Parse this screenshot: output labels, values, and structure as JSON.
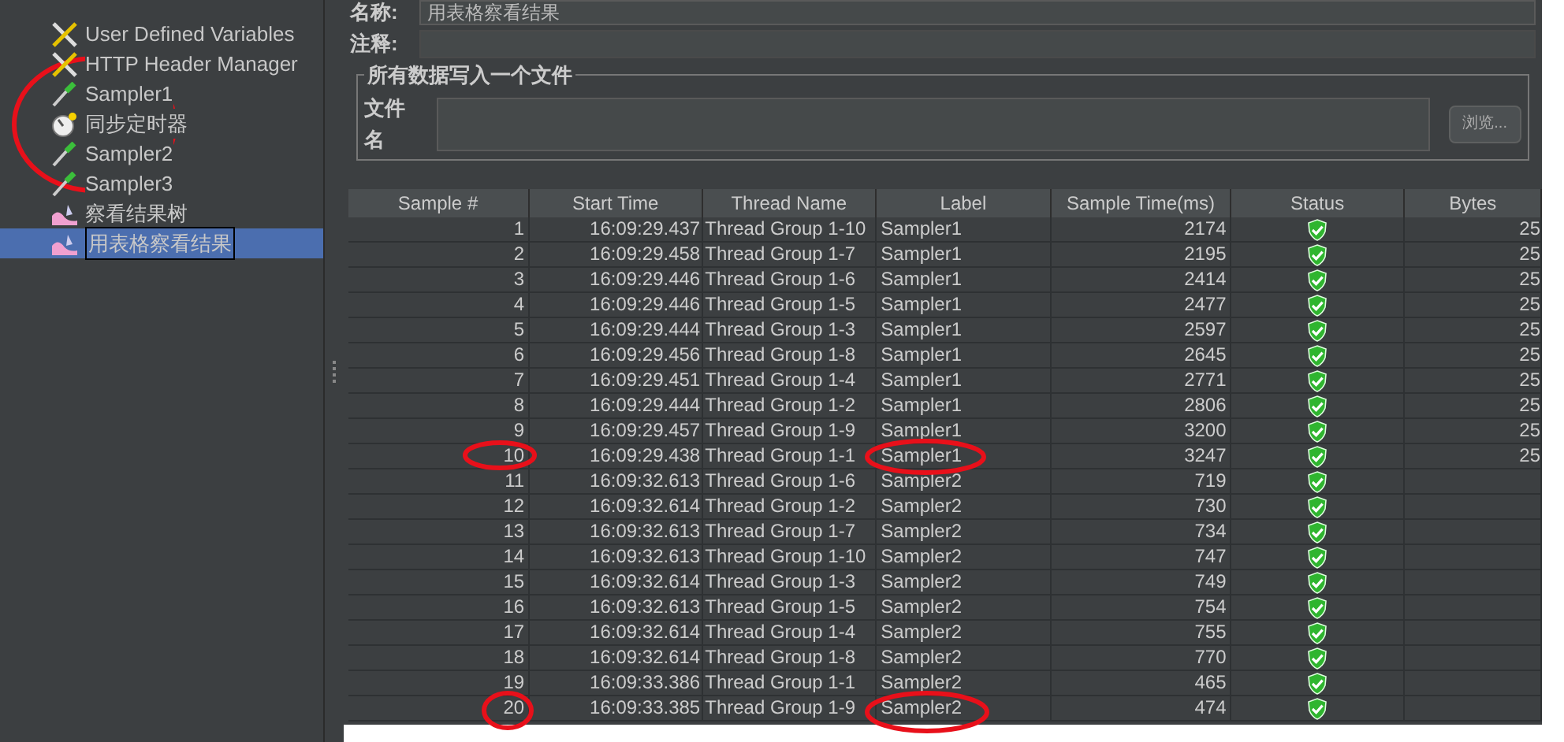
{
  "tree": {
    "items": [
      {
        "label": "User Defined Variables",
        "kind": "config",
        "selected": false
      },
      {
        "label": "HTTP Header Manager",
        "kind": "config",
        "selected": false
      },
      {
        "label": "Sampler1",
        "kind": "sampler",
        "selected": false
      },
      {
        "label": "同步定时器",
        "kind": "timer",
        "selected": false
      },
      {
        "label": "Sampler2",
        "kind": "sampler",
        "selected": false
      },
      {
        "label": "Sampler3",
        "kind": "sampler",
        "selected": false
      },
      {
        "label": "察看结果树",
        "kind": "listener",
        "selected": false
      },
      {
        "label": "用表格察看结果",
        "kind": "listener",
        "selected": true
      }
    ]
  },
  "form": {
    "name_label": "名称:",
    "name_value": "用表格察看结果",
    "comment_label": "注释:",
    "group_title": "所有数据写入一个文件",
    "file_label": "文件名",
    "browse_button": "浏览..."
  },
  "table": {
    "columns": [
      "Sample #",
      "Start Time",
      "Thread Name",
      "Label",
      "Sample Time(ms)",
      "Status",
      "Bytes"
    ],
    "rows": [
      {
        "n": "1",
        "start": "16:09:29.437",
        "thread": "Thread Group 1-10",
        "label": "Sampler1",
        "time": "2174",
        "passed": true,
        "bytes": "25"
      },
      {
        "n": "2",
        "start": "16:09:29.458",
        "thread": "Thread Group 1-7",
        "label": "Sampler1",
        "time": "2195",
        "passed": true,
        "bytes": "25"
      },
      {
        "n": "3",
        "start": "16:09:29.446",
        "thread": "Thread Group 1-6",
        "label": "Sampler1",
        "time": "2414",
        "passed": true,
        "bytes": "25"
      },
      {
        "n": "4",
        "start": "16:09:29.446",
        "thread": "Thread Group 1-5",
        "label": "Sampler1",
        "time": "2477",
        "passed": true,
        "bytes": "25"
      },
      {
        "n": "5",
        "start": "16:09:29.444",
        "thread": "Thread Group 1-3",
        "label": "Sampler1",
        "time": "2597",
        "passed": true,
        "bytes": "25"
      },
      {
        "n": "6",
        "start": "16:09:29.456",
        "thread": "Thread Group 1-8",
        "label": "Sampler1",
        "time": "2645",
        "passed": true,
        "bytes": "25"
      },
      {
        "n": "7",
        "start": "16:09:29.451",
        "thread": "Thread Group 1-4",
        "label": "Sampler1",
        "time": "2771",
        "passed": true,
        "bytes": "25"
      },
      {
        "n": "8",
        "start": "16:09:29.444",
        "thread": "Thread Group 1-2",
        "label": "Sampler1",
        "time": "2806",
        "passed": true,
        "bytes": "25"
      },
      {
        "n": "9",
        "start": "16:09:29.457",
        "thread": "Thread Group 1-9",
        "label": "Sampler1",
        "time": "3200",
        "passed": true,
        "bytes": "25"
      },
      {
        "n": "10",
        "start": "16:09:29.438",
        "thread": "Thread Group 1-1",
        "label": "Sampler1",
        "time": "3247",
        "passed": true,
        "bytes": "25"
      },
      {
        "n": "11",
        "start": "16:09:32.613",
        "thread": "Thread Group 1-6",
        "label": "Sampler2",
        "time": "719",
        "passed": true
      },
      {
        "n": "12",
        "start": "16:09:32.614",
        "thread": "Thread Group 1-2",
        "label": "Sampler2",
        "time": "730",
        "passed": true
      },
      {
        "n": "13",
        "start": "16:09:32.613",
        "thread": "Thread Group 1-7",
        "label": "Sampler2",
        "time": "734",
        "passed": true
      },
      {
        "n": "14",
        "start": "16:09:32.613",
        "thread": "Thread Group 1-10",
        "label": "Sampler2",
        "time": "747",
        "passed": true
      },
      {
        "n": "15",
        "start": "16:09:32.614",
        "thread": "Thread Group 1-3",
        "label": "Sampler2",
        "time": "749",
        "passed": true
      },
      {
        "n": "16",
        "start": "16:09:32.613",
        "thread": "Thread Group 1-5",
        "label": "Sampler2",
        "time": "754",
        "passed": true
      },
      {
        "n": "17",
        "start": "16:09:32.614",
        "thread": "Thread Group 1-4",
        "label": "Sampler2",
        "time": "755",
        "passed": true
      },
      {
        "n": "18",
        "start": "16:09:32.614",
        "thread": "Thread Group 1-8",
        "label": "Sampler2",
        "time": "770",
        "passed": true
      },
      {
        "n": "19",
        "start": "16:09:33.386",
        "thread": "Thread Group 1-1",
        "label": "Sampler2",
        "time": "465",
        "passed": true
      },
      {
        "n": "20",
        "start": "16:09:33.385",
        "thread": "Thread Group 1-9",
        "label": "Sampler2",
        "time": "474",
        "passed": true
      }
    ]
  }
}
